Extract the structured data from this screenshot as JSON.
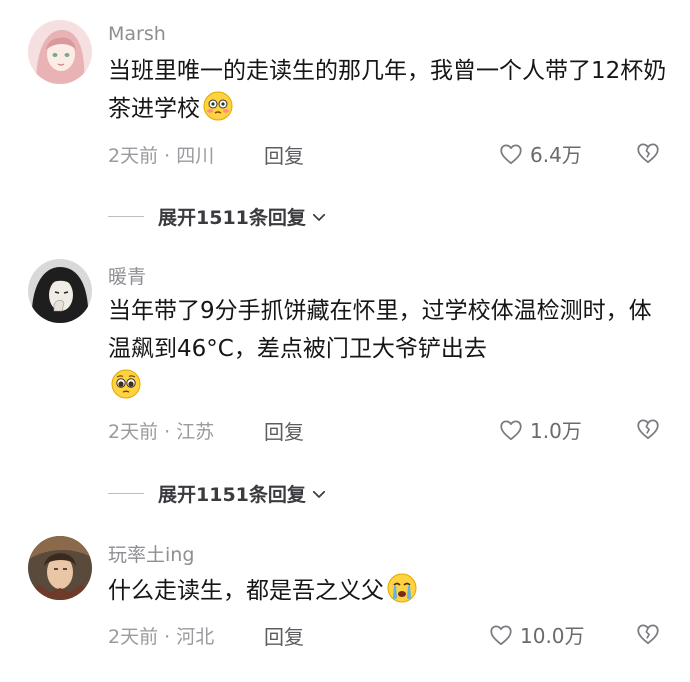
{
  "comments": [
    {
      "username": "Marsh",
      "text": "当班里唯一的走读生的那几年，我曾一个人带了12杯奶茶进学校",
      "meta": "2天前 · 四川",
      "reply_label": "回复",
      "likes": "6.4万",
      "expand_label": "展开1511条回复",
      "emoji": "flushed-face",
      "avatar": "anime-girl-pink"
    },
    {
      "username": "暖青",
      "text": "当年带了9分手抓饼藏在怀里，过学校体温检测时，体温飙到46°C，差点被门卫大爷铲出去",
      "meta": "2天前 · 江苏",
      "reply_label": "回复",
      "likes": "1.0万",
      "expand_label": "展开1151条回复",
      "emoji": "pleading-face",
      "avatar": "anime-man-dark"
    },
    {
      "username": "玩率土ing",
      "text": "什么走读生，都是吾之义父",
      "meta": "2天前 · 河北",
      "reply_label": "回复",
      "likes": "10.0万",
      "emoji": "crying-face",
      "avatar": "warrior-portrait"
    }
  ],
  "colors": {
    "username": "#8e8e93",
    "meta": "#9a9a9f",
    "text": "#161616"
  }
}
